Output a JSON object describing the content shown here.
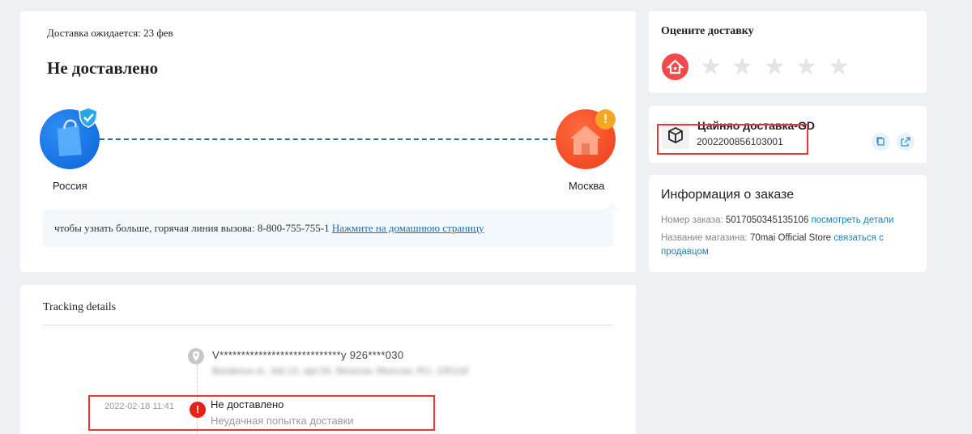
{
  "status": {
    "eta": "Доставка ожидается: 23 фев",
    "title": "Не доставлено",
    "origin": "Россия",
    "destination": "Москва",
    "hotline_text": "чтобы узнать больше, горячая линия вызова: 8-800-755-755-1",
    "hotline_link": "Нажмите на домашнюю страницу"
  },
  "tracking": {
    "title": "Tracking details",
    "address_masked": "V****************************y   926****030",
    "address_blurred": "Burakova st., bld.13, apt.34,  Moscow,  Moscow,  RU,  105118",
    "event": {
      "time": "2022-02-18 11:41",
      "title": "Не доставлено",
      "subtitle": "Неудачная попытка доставки"
    }
  },
  "rating": {
    "title": "Оцените доставку",
    "value": 0,
    "max": 5
  },
  "carrier": {
    "name": "Цайняо доставка-GD",
    "tracking_number": "2002200856103001"
  },
  "order": {
    "title": "Информация о заказе",
    "number_label": "Номер заказа:",
    "number": "5017050345135106",
    "details_link": "посмотреть детали",
    "store_label": "Название магазина:",
    "store": "70mai Official Store",
    "contact_link": "связаться с продавцом"
  },
  "colors": {
    "accent_red": "#e53935",
    "link_blue": "#1d7fb0",
    "origin_blue": "#0b63d8",
    "dest_orange": "#ec3d1a"
  },
  "icons": [
    "shield-check-icon",
    "house-icon",
    "warning-icon",
    "location-pin-icon",
    "error-icon",
    "package-icon",
    "copy-icon",
    "external-link-icon",
    "star-icon"
  ]
}
